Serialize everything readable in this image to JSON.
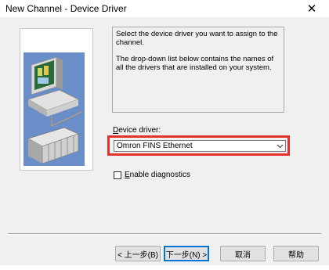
{
  "window": {
    "title": "New Channel - Device Driver",
    "close_glyph": "✕"
  },
  "info": {
    "line1": "Select the device driver you want to assign to the channel.",
    "line2": "The drop-down list below contains the names of all the drivers that are installed on your system."
  },
  "driver": {
    "label_accel": "D",
    "label_rest": "evice driver:",
    "selected": "Omron FINS Ethernet",
    "highlight_color": "#e8302c"
  },
  "diagnostics": {
    "label_accel": "E",
    "label_rest": "nable diagnostics",
    "checked": false
  },
  "buttons": {
    "back": "< 上一步(B)",
    "next": "下一步(N) >",
    "cancel": "取消",
    "help": "帮助"
  },
  "colors": {
    "accent": "#0078d7",
    "panel_bg": "#f0f0f0",
    "art_blue": "#6a8fc8"
  }
}
